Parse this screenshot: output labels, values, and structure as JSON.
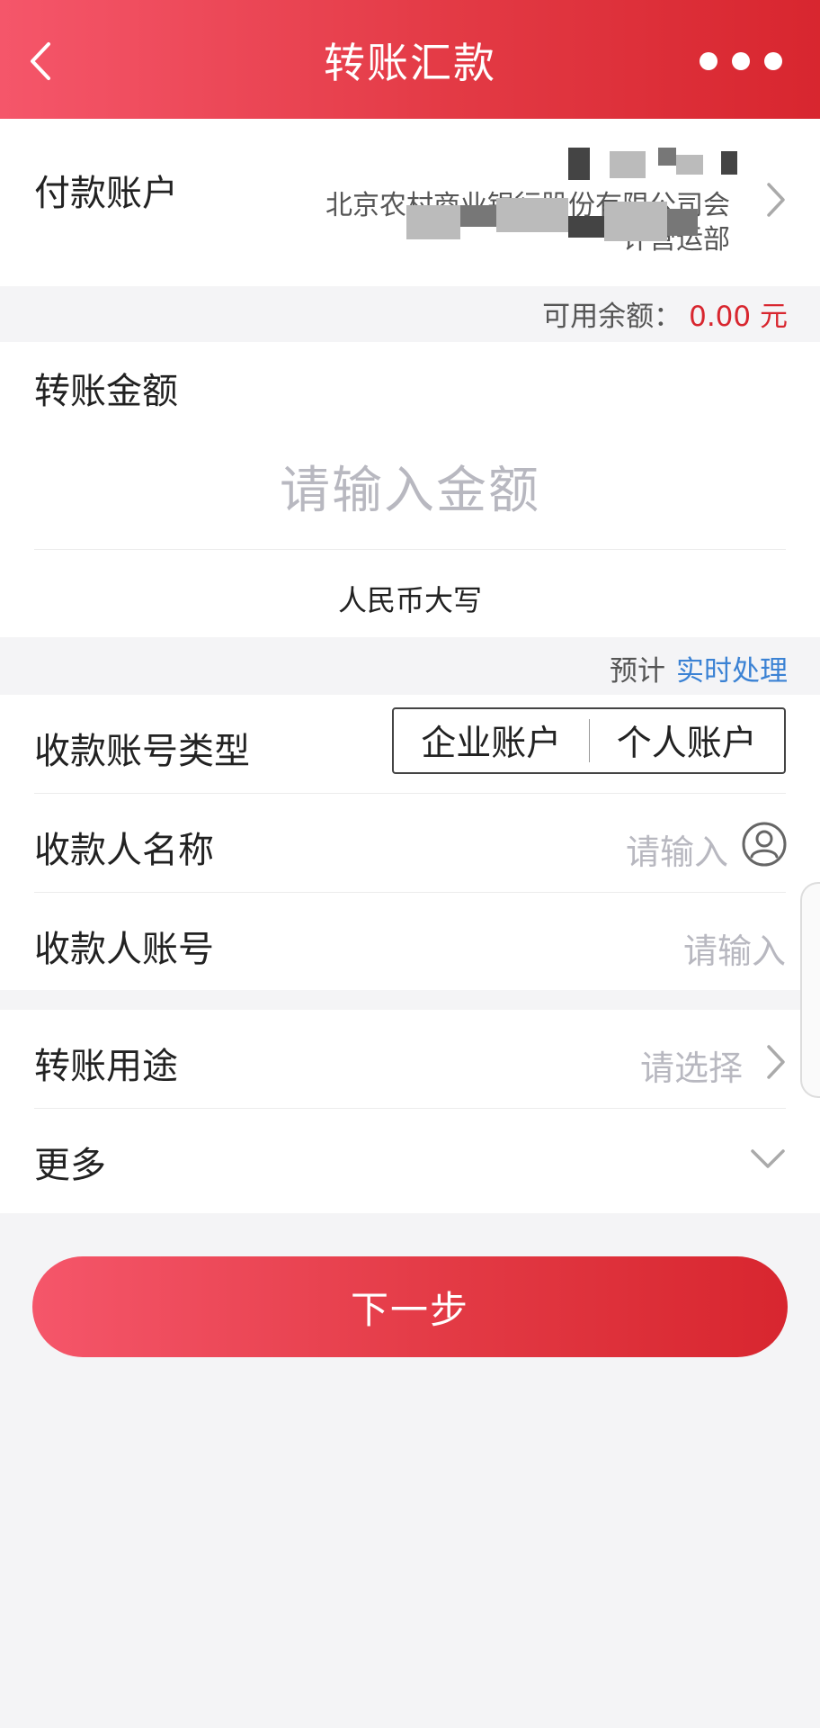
{
  "header": {
    "title": "转账汇款",
    "back_icon": "chevron-left-icon",
    "more_icon": "more-dots-icon"
  },
  "payer": {
    "label": "付款账户",
    "bank_name_line1": "北京农村商业银行股份有限公司会",
    "bank_name_line2": "计营运部"
  },
  "balance": {
    "label": "可用余额：",
    "amount": "0.00 元"
  },
  "amount": {
    "label": "转账金额",
    "placeholder": "请输入金额",
    "rmb_uppercase_label": "人民币大写"
  },
  "eta": {
    "label": "预计",
    "value": "实时处理"
  },
  "payee": {
    "type_label": "收款账号类型",
    "type_options": [
      "企业账户",
      "个人账户"
    ],
    "name_label": "收款人名称",
    "name_placeholder": "请输入",
    "account_label": "收款人账号",
    "account_placeholder": "请输入"
  },
  "purpose": {
    "label": "转账用途",
    "placeholder": "请选择"
  },
  "more": {
    "label": "更多"
  },
  "next_button": {
    "label": "下一步"
  },
  "colors": {
    "brand_red": "#e33a45",
    "link_blue": "#3b82d4",
    "placeholder_gray": "#b8b8c0"
  }
}
